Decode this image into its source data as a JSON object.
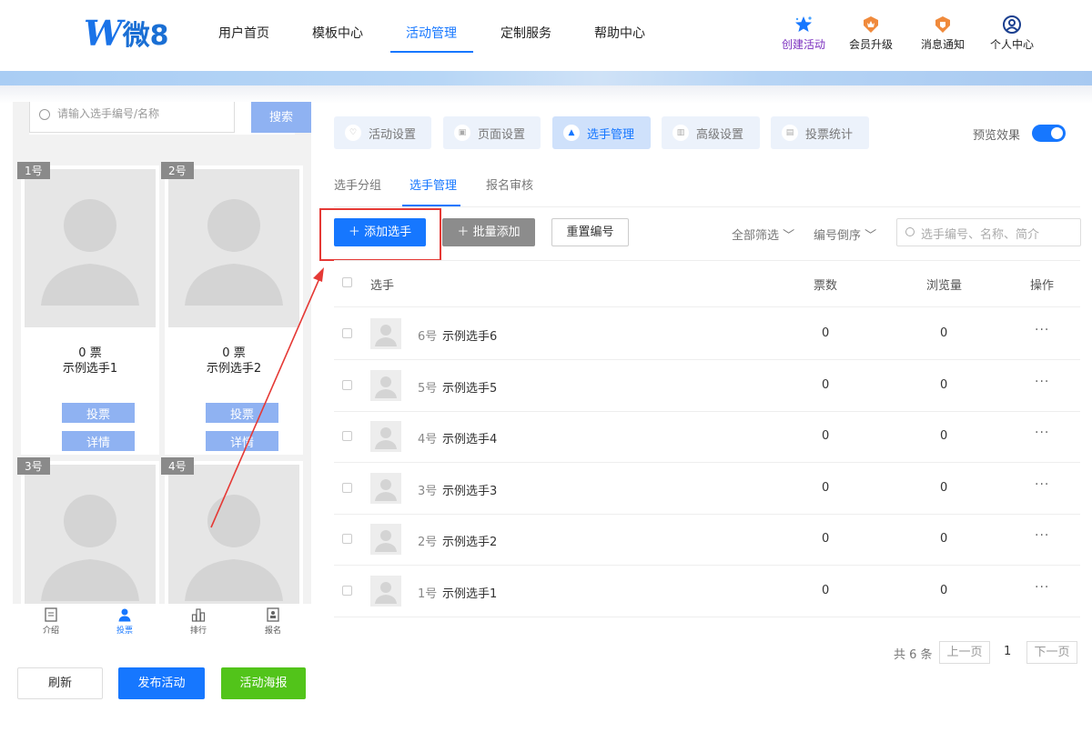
{
  "brand": {
    "logo_text": "微8"
  },
  "nav": {
    "items": [
      "用户首页",
      "模板中心",
      "活动管理",
      "定制服务",
      "帮助中心"
    ],
    "active": "活动管理"
  },
  "toolbar": {
    "create": "创建活动",
    "upgrade": "会员升级",
    "notify": "消息通知",
    "profile": "个人中心"
  },
  "preview": {
    "search_placeholder": "请输入选手编号/名称",
    "search_button": "搜索",
    "cards": [
      {
        "badge": "1号",
        "votes": "0 票",
        "name": "示例选手1",
        "vote_btn": "投票",
        "detail_btn": "详情"
      },
      {
        "badge": "2号",
        "votes": "0 票",
        "name": "示例选手2",
        "vote_btn": "投票",
        "detail_btn": "详情"
      },
      {
        "badge": "3号"
      },
      {
        "badge": "4号"
      }
    ],
    "tabbar": [
      "介绍",
      "投票",
      "排行",
      "报名"
    ],
    "tabbar_active": "投票"
  },
  "actions": {
    "refresh": "刷新",
    "publish": "发布活动",
    "poster": "活动海报"
  },
  "settings_tabs": [
    "活动设置",
    "页面设置",
    "选手管理",
    "高级设置",
    "投票统计"
  ],
  "settings_active": "选手管理",
  "preview_toggle": {
    "label": "预览效果",
    "on": true
  },
  "subtabs": [
    "选手分组",
    "选手管理",
    "报名审核"
  ],
  "subtab_active": "选手管理",
  "buttons": {
    "add": "添加选手",
    "batch": "批量添加",
    "renumber": "重置编号"
  },
  "filters": {
    "all": "全部筛选",
    "order": "编号倒序"
  },
  "search": {
    "placeholder": "选手编号、名称、简介"
  },
  "table": {
    "headers": {
      "player": "选手",
      "votes": "票数",
      "views": "浏览量",
      "ops": "操作"
    },
    "rows": [
      {
        "num": "6号",
        "name": "示例选手6",
        "votes": "0",
        "views": "0",
        "ops": "···"
      },
      {
        "num": "5号",
        "name": "示例选手5",
        "votes": "0",
        "views": "0",
        "ops": "···"
      },
      {
        "num": "4号",
        "name": "示例选手4",
        "votes": "0",
        "views": "0",
        "ops": "···"
      },
      {
        "num": "3号",
        "name": "示例选手3",
        "votes": "0",
        "views": "0",
        "ops": "···"
      },
      {
        "num": "2号",
        "name": "示例选手2",
        "votes": "0",
        "views": "0",
        "ops": "···"
      },
      {
        "num": "1号",
        "name": "示例选手1",
        "votes": "0",
        "views": "0",
        "ops": "···"
      }
    ]
  },
  "pager": {
    "total": "共 6 条",
    "prev": "上一页",
    "current": "1",
    "next": "下一页"
  },
  "colors": {
    "primary": "#1677ff",
    "green": "#52c41a",
    "annotation": "#e53935"
  }
}
